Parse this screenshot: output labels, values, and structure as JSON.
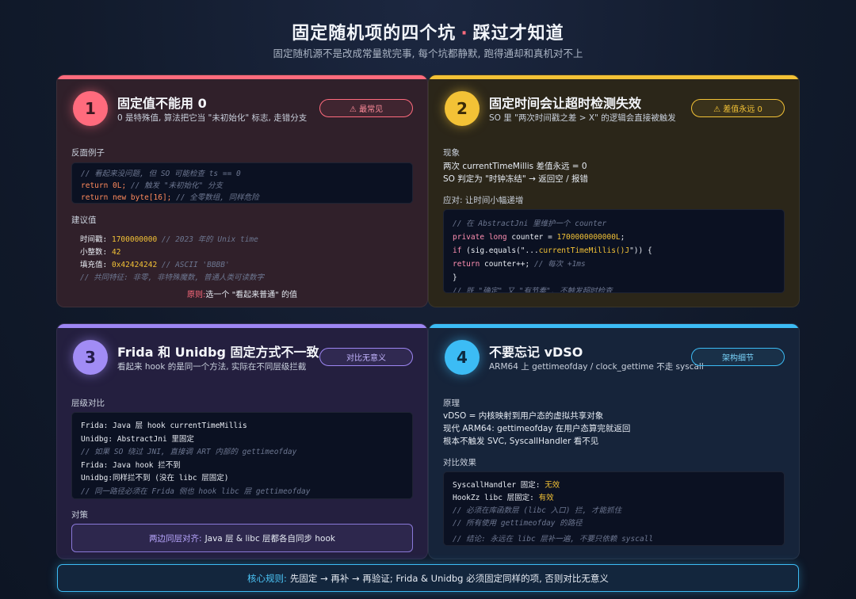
{
  "header": {
    "title_left": "固定随机项的四个坑",
    "title_dot": "·",
    "title_right": "踩过才知道",
    "subtitle": "固定随机源不是改成常量就完事, 每个坑都静默, 跑得通却和真机对不上"
  },
  "card1": {
    "number": "1",
    "title": "固定值不能用 0",
    "desc": "0 是特殊值, 算法把它当 \"未初始化\" 标志, 走错分支",
    "badge": "⚠ 最常见",
    "section1": "反面例子",
    "code": [
      "// 看起来没问题, 但 SO 可能检查 ts == 0",
      "return 0L;",
      "// 触发 \"未初始化\" 分支",
      "return new byte[16];",
      "// 全零数组, 同样危险"
    ],
    "section2": "建议值",
    "suggest": {
      "ts_label": "时间戳:",
      "ts_value": "1700000000",
      "ts_comment": "// 2023 年的 Unix time",
      "int_label": "小整数:",
      "int_value": "42",
      "fill_label": "填充值:",
      "fill_value": "0x42424242",
      "fill_comment": "// ASCII 'BBBB'",
      "common": "// 共同特征: 非零, 非特殊魔数, 普通人类可读数字"
    },
    "principle_key": "原则:",
    "principle_text": "选一个 \"看起来普通\" 的值"
  },
  "card2": {
    "number": "2",
    "title": "固定时间会让超时检测失效",
    "desc": "SO 里 \"两次时间戳之差 > X\" 的逻辑会直接被触发",
    "badge": "⚠ 差值永远 0",
    "section1": "现象",
    "phenomenon": [
      "两次 currentTimeMillis 差值永远 = 0",
      "SO 判定为 \"时钟冻结\" → 返回空 / 报错"
    ],
    "section2": "应对: 让时间小幅递增",
    "code": {
      "c1": "// 在 AbstractJni 里维护一个 counter",
      "l2_kw": "private long",
      "l2_name": " counter = ",
      "l2_num": "1700000000000L",
      "l2_end": ";",
      "l3_kw": "if",
      "l3_a": " (sig.equals(\"...",
      "l3_fn": "currentTimeMillis()J",
      "l3_b": "\")) {",
      "l4_kw": "return",
      "l4_a": " counter++; ",
      "l4_c": "// 每次 +1ms",
      "l5": "}",
      "c6": "// 既 \"确定\" 又 \"有节奏\", 不触发超时检查"
    }
  },
  "card3": {
    "number": "3",
    "title": "Frida 和 Unidbg 固定方式不一致",
    "desc": "看起来 hook 的是同一个方法, 实际在不同层级拦截",
    "badge": "对比无意义",
    "section1": "层级对比",
    "code": {
      "l1_k": "Frida:",
      "l1_v": " Java 层 hook currentTimeMillis",
      "l2_k": "Unidbg:",
      "l2_v": " AbstractJni 里固定",
      "c3": "// 如果 SO 绕过 JNI, 直接调 ART 内部的 gettimeofday",
      "l4_k": "Frida:",
      "l4_v": " Java hook 拦不到",
      "l5_k": "Unidbg:",
      "l5_v": "同样拦不到 (没在 libc 层固定)",
      "c6": "// 同一路径必须在 Frida 侧也 hook libc 层 gettimeofday"
    },
    "section2": "对策",
    "policy_key": "两边同层对齐:",
    "policy_text": "Java 层 & libc 层都各自同步 hook"
  },
  "card4": {
    "number": "4",
    "title": "不要忘记 vDSO",
    "desc": "ARM64 上 gettimeofday / clock_gettime 不走 syscall",
    "badge": "架构细节",
    "section1": "原理",
    "principle": [
      "vDSO = 内核映射到用户态的虚拟共享对象",
      "现代 ARM64: gettimeofday 在用户态算完就返回",
      "根本不触发 SVC, SyscallHandler 看不见"
    ],
    "section2": "对比效果",
    "code": {
      "l1_k": "SyscallHandler 固定: ",
      "l1_v": "无效",
      "l2_k": "HookZz libc 层固定: ",
      "l2_v": "有效",
      "c3": "// 必须在库函数层 (libc 入口) 拦, 才能抓住",
      "c4": "// 所有使用 gettimeofday 的路径",
      "c5": "// 结论: 永远在 libc 层补一遍, 不要只依赖 syscall"
    }
  },
  "rule": {
    "key": "核心规则:",
    "text": "先固定 → 再补 → 再验证; Frida & Unidbg 必须固定同样的项, 否则对比无意义"
  },
  "colors": {
    "card1_accent": "#ff6b7d",
    "card2_accent": "#f3c236",
    "card3_accent": "#9d86f3",
    "card4_accent": "#3cbcf5"
  }
}
